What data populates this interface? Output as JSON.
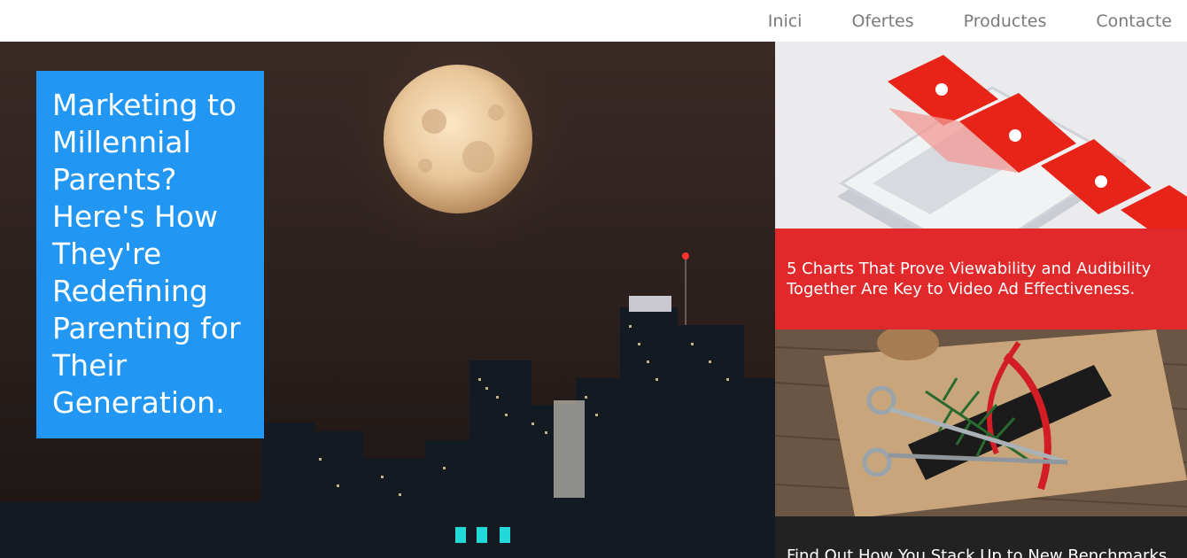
{
  "nav": {
    "items": [
      {
        "label": "Inici"
      },
      {
        "label": "Ofertes"
      },
      {
        "label": "Productes"
      },
      {
        "label": "Contacte"
      }
    ]
  },
  "hero": {
    "title": "Marketing to Millennial Parents? Here's How They're Redefining Parenting for Their Generation."
  },
  "side": {
    "articles": [
      {
        "title": "5 Charts That Prove Viewability and Audibility Together Are Key to Video Ad Effectiveness."
      },
      {
        "title": "Find Out How You Stack Up to New Benchmarks"
      }
    ]
  },
  "colors": {
    "nav_text": "#7a7a7a",
    "hero_card": "#2196f3",
    "caption_red": "#e1292b",
    "caption_dark": "#222222"
  }
}
